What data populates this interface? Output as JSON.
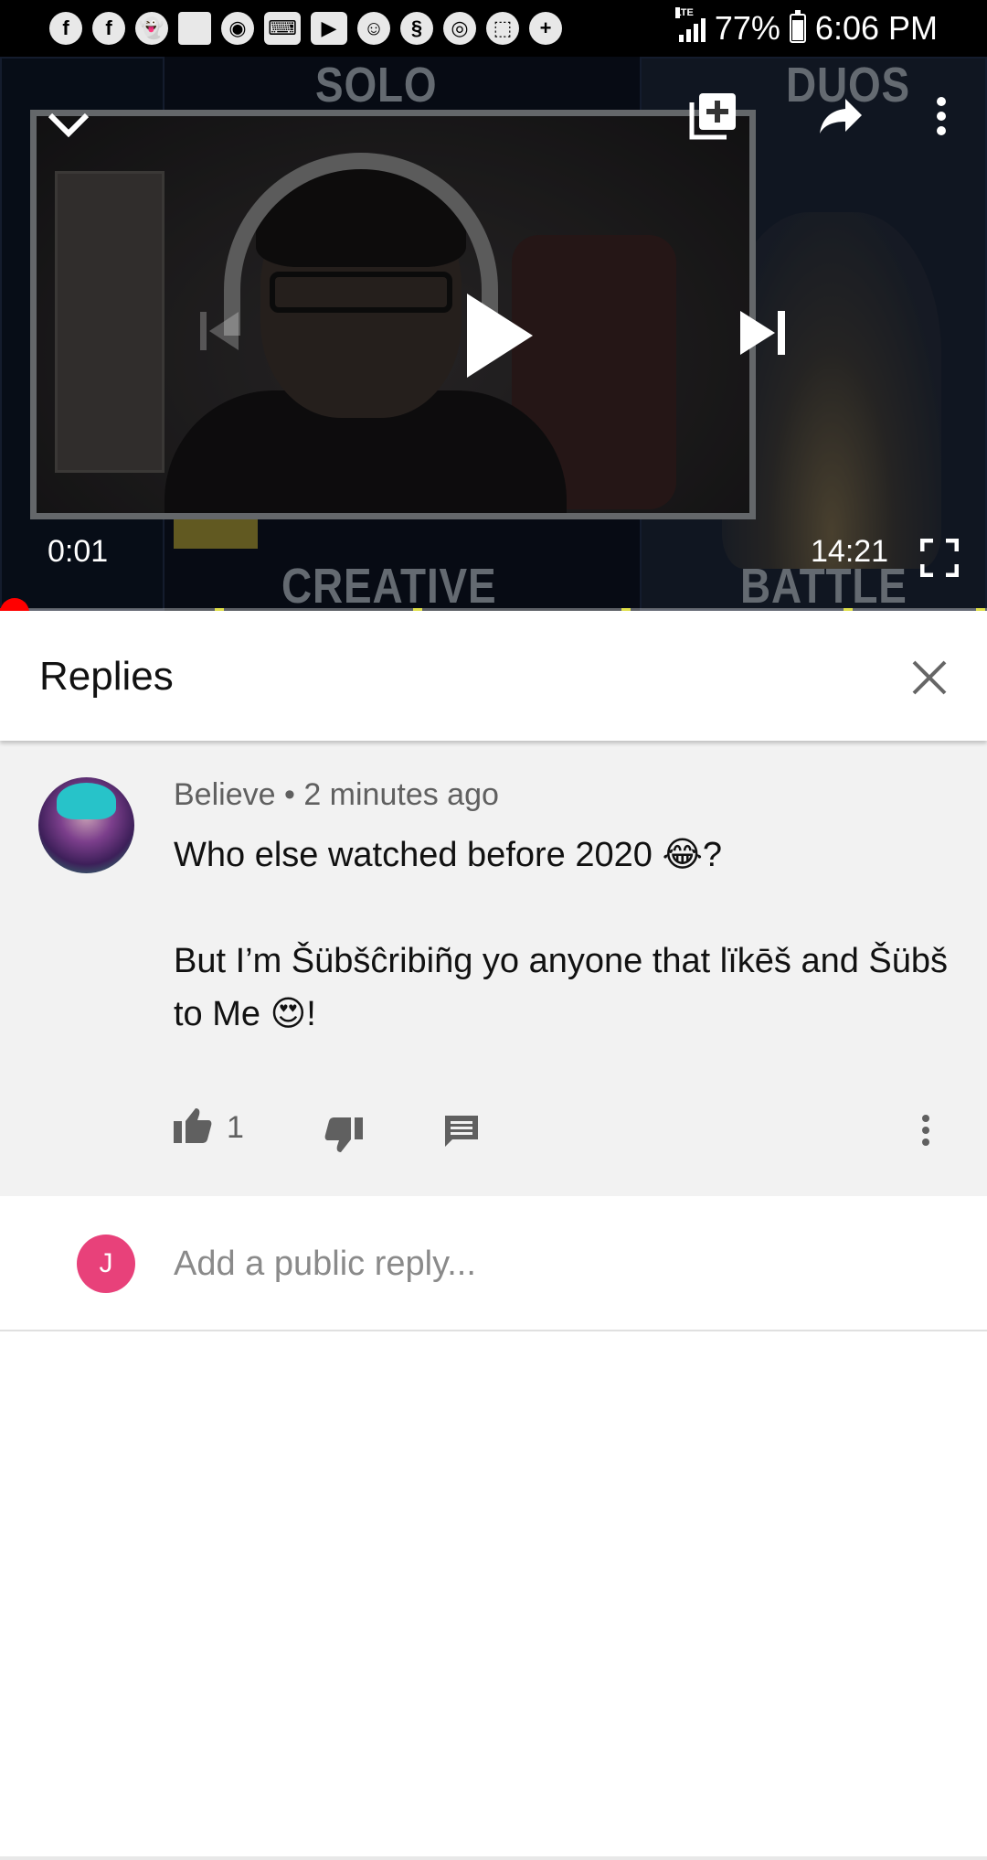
{
  "status_bar": {
    "notifications": [
      {
        "icon": "facebook-icon",
        "glyph": "f"
      },
      {
        "icon": "facebook-icon",
        "glyph": "f"
      },
      {
        "icon": "snapchat-icon",
        "glyph": "👻"
      },
      {
        "icon": "image-icon",
        "glyph": ""
      },
      {
        "icon": "reddit-icon",
        "glyph": "◉"
      },
      {
        "icon": "keyboard-icon",
        "glyph": "⌨"
      },
      {
        "icon": "youtube-icon",
        "glyph": "▶"
      },
      {
        "icon": "smiley-icon",
        "glyph": "☺"
      },
      {
        "icon": "app-icon",
        "glyph": "§"
      },
      {
        "icon": "instagram-icon",
        "glyph": "◎"
      },
      {
        "icon": "twitch-icon",
        "glyph": "⬚"
      },
      {
        "icon": "battery-saver-icon",
        "glyph": "+"
      }
    ],
    "network": "LTE",
    "battery_percent": "77%",
    "time": "6:06 PM"
  },
  "player": {
    "current_time": "0:01",
    "total_time": "14:21",
    "progress": 0.001,
    "background_labels": {
      "solo": "SOLO",
      "duos": "DUOS",
      "creative": "CREATIVE",
      "battle": "BATTLE LAB"
    },
    "icons": {
      "collapse": "chevron-down-icon",
      "add_to_playlist": "add-to-playlist-icon",
      "share": "share-icon",
      "more": "more-vert-icon",
      "previous": "skip-previous-icon",
      "play": "play-icon",
      "next": "skip-next-icon",
      "fullscreen": "fullscreen-icon"
    },
    "accent_color": "#ff0000"
  },
  "replies_panel": {
    "title": "Replies",
    "close_icon": "close-icon"
  },
  "comment": {
    "author": "Believe",
    "separator": "•",
    "time_ago": "2 minutes ago",
    "lines": [
      "Who else watched before 2020 😂?",
      "",
      "But I’m Šübšĉribiñg yo anyone that lïkēš and Šübš to Me 😍!"
    ],
    "like_count": "1",
    "icons": {
      "like": "thumb-up-icon",
      "dislike": "thumb-down-icon",
      "reply": "comment-icon",
      "more": "more-vert-icon"
    }
  },
  "reply_box": {
    "user_initial": "J",
    "avatar_color": "#e8417a",
    "placeholder": "Add a public reply..."
  }
}
